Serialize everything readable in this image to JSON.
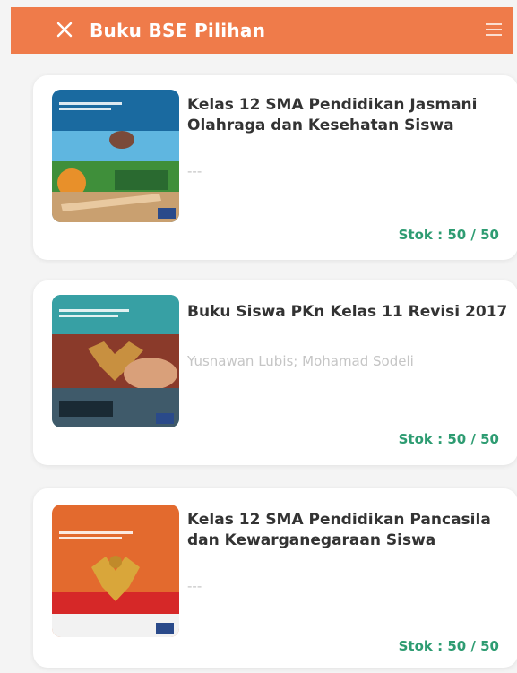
{
  "header": {
    "title": "Buku BSE Pilihan",
    "close_icon": "close-icon",
    "menu_icon": "menu-icon",
    "background": "#ef7b4a"
  },
  "books": [
    {
      "title": "Kelas 12 SMA Pendidikan Jasmani Olahraga dan Kesehatan Siswa",
      "author": "---",
      "stock": "Stok : 50 / 50"
    },
    {
      "title": "Buku Siswa PKn Kelas 11 Revisi 2017",
      "author": "Yusnawan Lubis; Mohamad Sodeli",
      "stock": "Stok : 50 / 50"
    },
    {
      "title": "Kelas 12 SMA Pendidikan Pancasila dan Kewarganegaraan Siswa",
      "author": "---",
      "stock": "Stok : 50 / 50"
    }
  ],
  "colors": {
    "accent": "#ef7b4a",
    "stock": "#2e9c72",
    "title": "#333333",
    "author": "#c5c5c5"
  }
}
